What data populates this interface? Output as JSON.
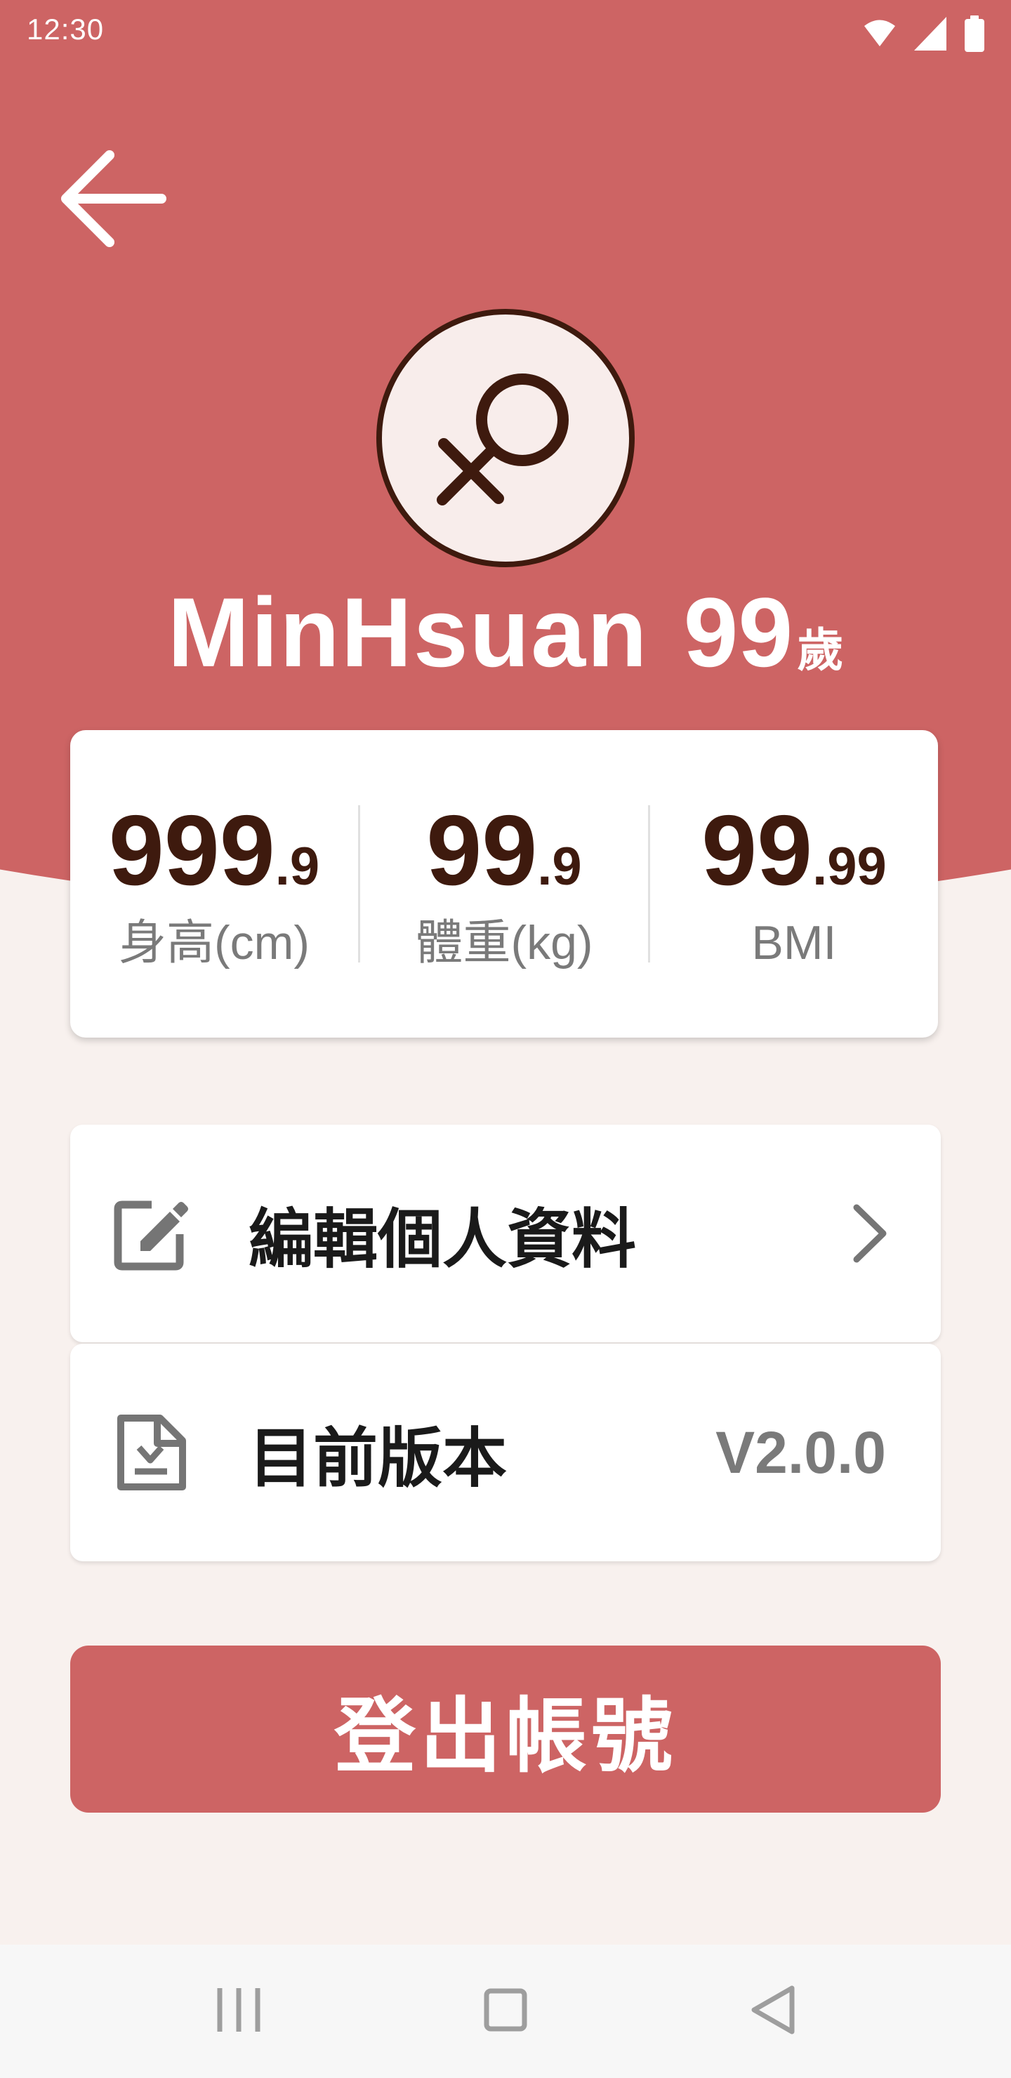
{
  "status_bar": {
    "time": "12:30",
    "icons": [
      "wifi-icon",
      "cellular-signal-icon",
      "battery-icon"
    ]
  },
  "header": {
    "back_icon": "arrow-left-icon"
  },
  "profile": {
    "avatar_icon": "female-symbol-icon",
    "name": "MinHsuan",
    "age": "99",
    "age_unit": "歲"
  },
  "stats": [
    {
      "int": "999",
      "dec": ".9",
      "label": "身高(cm)"
    },
    {
      "int": "99",
      "dec": ".9",
      "label": "體重(kg)"
    },
    {
      "int": "99",
      "dec": ".99",
      "label": "BMI"
    }
  ],
  "menu": {
    "edit_profile": {
      "icon": "edit-note-icon",
      "label": "編輯個人資料",
      "chevron": "chevron-right-icon"
    },
    "version": {
      "icon": "document-download-icon",
      "label": "目前版本",
      "value": "V2.0.0"
    }
  },
  "logout": {
    "label": "登出帳號"
  },
  "nav_bar": {
    "icons": [
      "recent-apps-icon",
      "home-icon",
      "back-triangle-icon"
    ]
  },
  "colors": {
    "brand": "#CD6464",
    "accent_dark": "#3E1A0E",
    "background": "#F8F1EE",
    "muted_text": "#7A7A7A"
  }
}
